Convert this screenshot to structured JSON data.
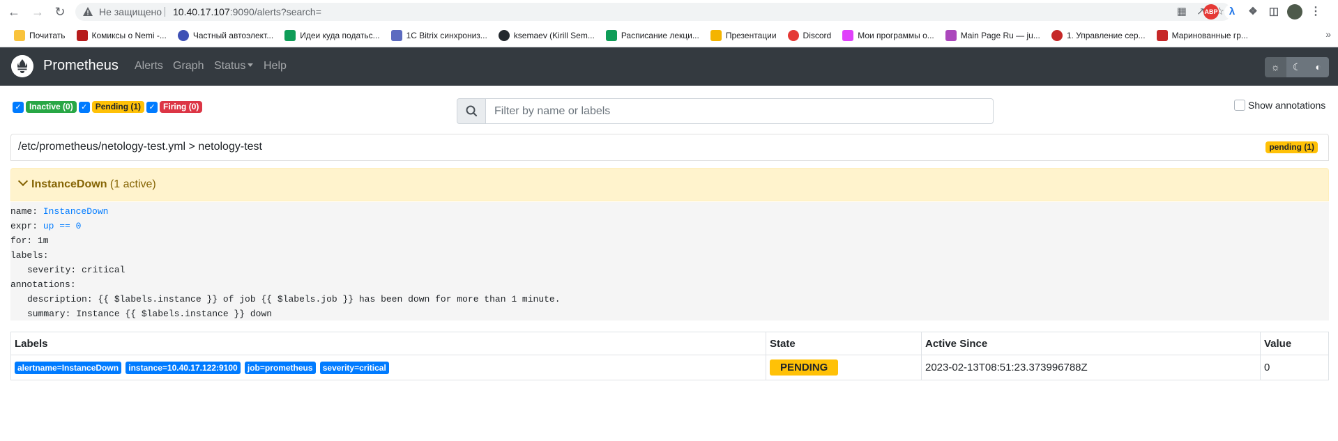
{
  "browser": {
    "security_status": "Не защищено",
    "url_host": "10.40.17.107",
    "url_rest": ":9090/alerts?search=",
    "bookmarks": [
      {
        "label": "Почитать",
        "color": "#f9c33c"
      },
      {
        "label": "Комиксы о Nemi -...",
        "color": "#b71c1c"
      },
      {
        "label": "Частный автоэлект...",
        "color": "#3f51b5"
      },
      {
        "label": "Идеи куда податьс...",
        "color": "#0f9d58"
      },
      {
        "label": "1C Bitrix синхрониз...",
        "color": "#5c6bc0"
      },
      {
        "label": "ksemaev (Kirill Sem...",
        "color": "#24292e"
      },
      {
        "label": "Расписание лекци...",
        "color": "#0f9d58"
      },
      {
        "label": "Презентации",
        "color": "#f4b400"
      },
      {
        "label": "Discord",
        "color": "#e53935"
      },
      {
        "label": "Мои программы о...",
        "color": "#e040fb"
      },
      {
        "label": "Main Page Ru — ju...",
        "color": "#ab47bc"
      },
      {
        "label": "1. Управление сер...",
        "color": "#c62828"
      },
      {
        "label": "Маринованные гр...",
        "color": "#c62828"
      }
    ],
    "bookmarks_more": "»"
  },
  "navbar": {
    "brand": "Prometheus",
    "links": {
      "alerts": "Alerts",
      "graph": "Graph",
      "status": "Status",
      "help": "Help"
    }
  },
  "filters": {
    "inactive": "Inactive (0)",
    "pending": "Pending (1)",
    "firing": "Firing (0)",
    "search_placeholder": "Filter by name or labels",
    "search_value": "",
    "show_annotations": "Show annotations"
  },
  "group": {
    "path": "/etc/prometheus/netology-test.yml > netology-test",
    "badge": "pending (1)"
  },
  "alert_rule": {
    "name": "InstanceDown",
    "active_count": "(1 active)",
    "definition": {
      "name_key": "name: ",
      "name_val": "InstanceDown",
      "expr_key": "expr: ",
      "expr_val": "up == 0",
      "for_line": "for: 1m",
      "labels_line": "labels:",
      "severity_line": "severity: critical",
      "annotations_line": "annotations:",
      "description_line": "description: {{ $labels.instance }} of job {{ $labels.job }} has been down for more than 1 minute.",
      "summary_line": "summary: Instance {{ $labels.instance }} down"
    }
  },
  "table": {
    "headers": {
      "labels": "Labels",
      "state": "State",
      "active_since": "Active Since",
      "value": "Value"
    },
    "rows": [
      {
        "labels": [
          "alertname=InstanceDown",
          "instance=10.40.17.122:9100",
          "job=prometheus",
          "severity=critical"
        ],
        "state": "PENDING",
        "active_since": "2023-02-13T08:51:23.373996788Z",
        "value": "0"
      }
    ]
  },
  "colors": {
    "navbar": "#343a40",
    "primary": "#007bff",
    "warning": "#ffc107",
    "success": "#28a745",
    "danger": "#dc3545"
  }
}
